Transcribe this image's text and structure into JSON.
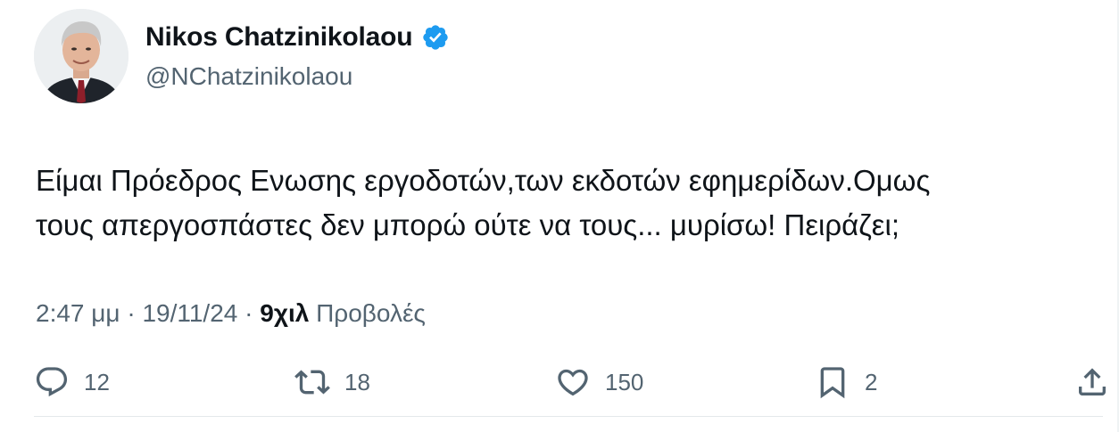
{
  "author": {
    "display_name": "Nikos Chatzinikolaou",
    "handle": "@NChatzinikolaou",
    "verified_icon": "verified-badge-icon",
    "verified_color": "#1d9bf0"
  },
  "tweet": {
    "text_lines": [
      "Είμαι Πρόεδρος Ενωσης εργοδοτών,των εκδοτών εφημερίδων.Ομως",
      "τους απεργοσπάστες δεν μπορώ ούτε να τους... μυρίσω! Πειράζει;"
    ]
  },
  "meta": {
    "time": "2:47 μμ",
    "separator": " · ",
    "date": "19/11/24",
    "views_count": "9χιλ",
    "views_label": "Προβολές"
  },
  "actions": {
    "reply": {
      "icon": "reply-icon",
      "count": "12"
    },
    "retweet": {
      "icon": "retweet-icon",
      "count": "18"
    },
    "like": {
      "icon": "heart-icon",
      "count": "150"
    },
    "bookmark": {
      "icon": "bookmark-icon",
      "count": "2"
    },
    "share": {
      "icon": "share-icon"
    }
  },
  "colors": {
    "text_primary": "#0f1419",
    "text_secondary": "#536471",
    "accent": "#1d9bf0"
  }
}
